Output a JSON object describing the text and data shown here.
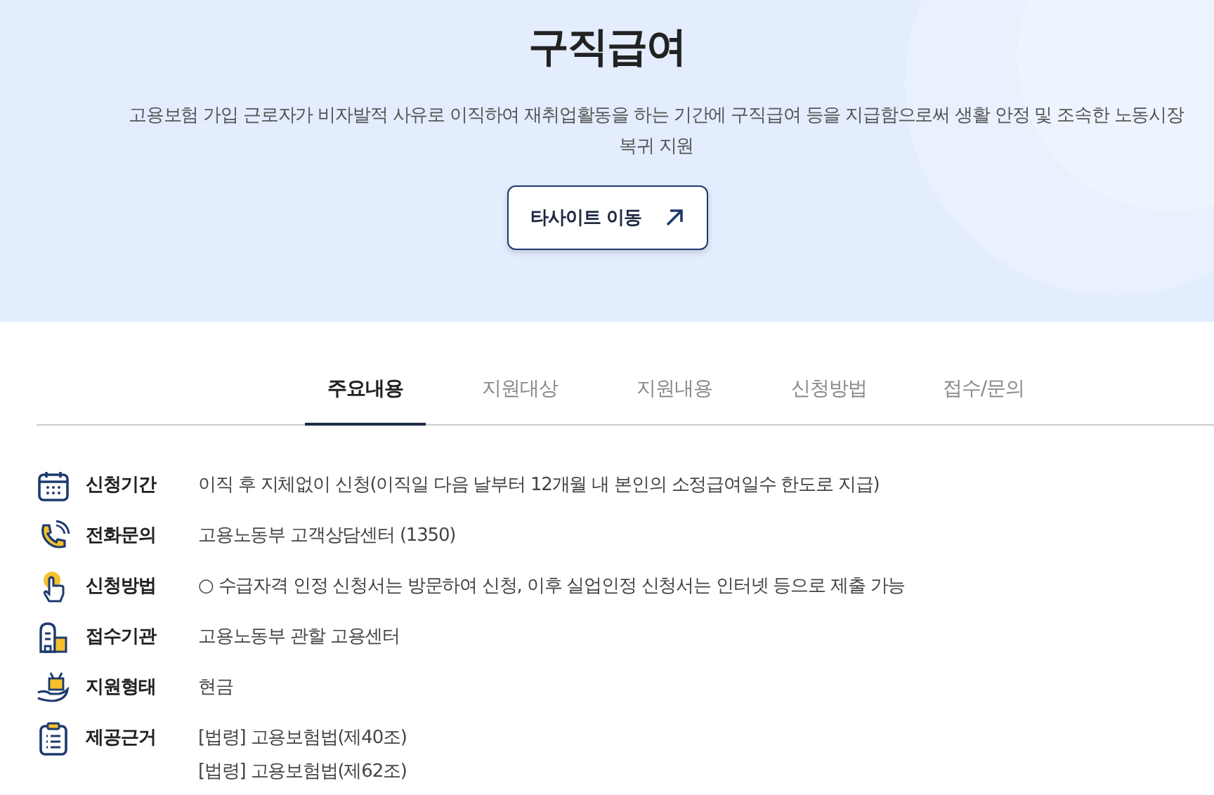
{
  "hero": {
    "title": "구직급여",
    "description": "고용보험 가입 근로자가 비자발적 사유로 이직하여 재취업활동을 하는 기간에 구직급여 등을 지급함으로써 생활 안정 및 조속한 노동시장 복귀 지원",
    "button": "타사이트 이동"
  },
  "tabs": [
    {
      "label": "주요내용",
      "selected": true
    },
    {
      "label": "지원대상",
      "selected": false
    },
    {
      "label": "지원내용",
      "selected": false
    },
    {
      "label": "신청방법",
      "selected": false
    },
    {
      "label": "접수/문의",
      "selected": false
    }
  ],
  "details": [
    {
      "label": "신청기간",
      "values": [
        "이직 후 지체없이 신청(이직일 다음 날부터 12개월 내 본인의 소정급여일수 한도로 지급)"
      ]
    },
    {
      "label": "전화문의",
      "values": [
        "고용노동부 고객상담센터 (1350)"
      ]
    },
    {
      "label": "신청방법",
      "values": [
        "○ 수급자격 인정 신청서는 방문하여 신청, 이후 실업인정 신청서는 인터넷 등으로 제출 가능"
      ]
    },
    {
      "label": "접수기관",
      "values": [
        "고용노동부 관할 고용센터"
      ]
    },
    {
      "label": "지원형태",
      "values": [
        "현금"
      ]
    },
    {
      "label": "제공근거",
      "values": [
        "[법령] 고용보험법(제40조)",
        "[법령] 고용보험법(제62조)"
      ]
    }
  ]
}
